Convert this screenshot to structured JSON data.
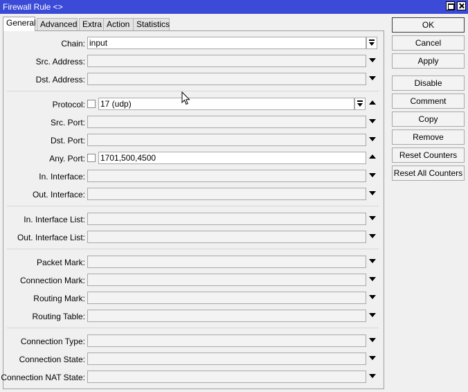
{
  "window": {
    "title": "Firewall Rule <>"
  },
  "tabs": [
    "General",
    "Advanced",
    "Extra",
    "Action",
    "Statistics"
  ],
  "fields": {
    "chain": {
      "label": "Chain:",
      "value": "input"
    },
    "src_address": {
      "label": "Src. Address:",
      "value": ""
    },
    "dst_address": {
      "label": "Dst. Address:",
      "value": ""
    },
    "protocol": {
      "label": "Protocol:",
      "value": "17 (udp)"
    },
    "src_port": {
      "label": "Src. Port:",
      "value": ""
    },
    "dst_port": {
      "label": "Dst. Port:",
      "value": ""
    },
    "any_port": {
      "label": "Any. Port:",
      "value": "1701,500,4500"
    },
    "in_interface": {
      "label": "In. Interface:",
      "value": ""
    },
    "out_interface": {
      "label": "Out. Interface:",
      "value": ""
    },
    "in_interface_list": {
      "label": "In. Interface List:",
      "value": ""
    },
    "out_interface_list": {
      "label": "Out. Interface List:",
      "value": ""
    },
    "packet_mark": {
      "label": "Packet Mark:",
      "value": ""
    },
    "connection_mark": {
      "label": "Connection Mark:",
      "value": ""
    },
    "routing_mark": {
      "label": "Routing Mark:",
      "value": ""
    },
    "routing_table": {
      "label": "Routing Table:",
      "value": ""
    },
    "connection_type": {
      "label": "Connection Type:",
      "value": ""
    },
    "connection_state": {
      "label": "Connection State:",
      "value": ""
    },
    "connection_nat_state": {
      "label": "Connection NAT State:",
      "value": ""
    }
  },
  "buttons": {
    "ok": "OK",
    "cancel": "Cancel",
    "apply": "Apply",
    "disable": "Disable",
    "comment": "Comment",
    "copy": "Copy",
    "remove": "Remove",
    "reset_counters": "Reset Counters",
    "reset_all_counters": "Reset All Counters"
  }
}
